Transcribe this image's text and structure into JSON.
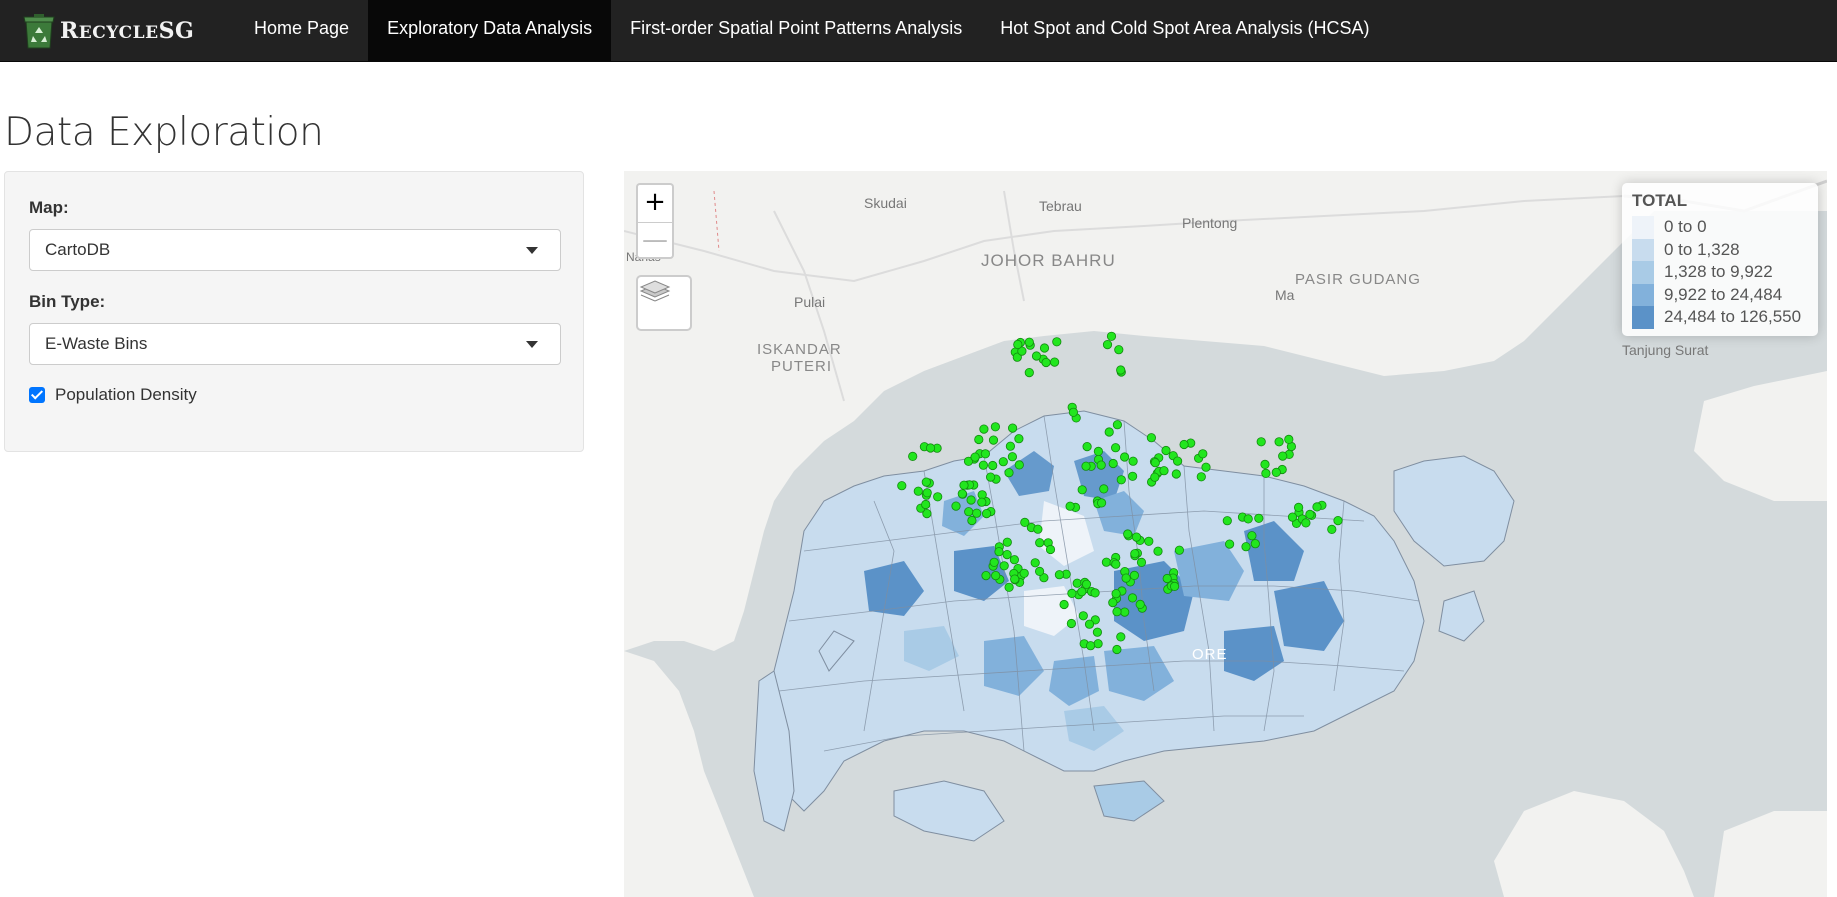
{
  "brand": {
    "name_big": "R",
    "name_rest": "ECYCLE",
    "name_sg": "SG"
  },
  "nav": {
    "items": [
      {
        "label": "Home Page",
        "active": false
      },
      {
        "label": "Exploratory Data Analysis",
        "active": true
      },
      {
        "label": "First-order Spatial Point Patterns Analysis",
        "active": false
      },
      {
        "label": "Hot Spot and Cold Spot Area Analysis (HCSA)",
        "active": false
      }
    ]
  },
  "page": {
    "title": "Data Exploration"
  },
  "sidebar": {
    "map_label": "Map:",
    "map_value": "CartoDB",
    "bin_label": "Bin Type:",
    "bin_value": "E-Waste Bins",
    "population_label": "Population Density",
    "population_checked": true
  },
  "map": {
    "zoom_in": "+",
    "zoom_out": "—",
    "places": {
      "skudai": "Skudai",
      "tebrau": "Tebrau",
      "plentong": "Plentong",
      "johor_bahru": "JOHOR BAHRU",
      "pasir_gudang": "PASIR GUDANG",
      "ma": "Ma",
      "pulai": "Pulai",
      "iskandar": "ISKANDAR",
      "puteri": "PUTERI",
      "tanjung_surat": "Tanjung Surat",
      "nanas": "Nanas",
      "singapore_partial": "ORE"
    },
    "legend": {
      "title": "TOTAL",
      "entries": [
        {
          "label": "0 to 0",
          "color": "#eef3f9"
        },
        {
          "label": "0 to 1,328",
          "color": "#c8dcee"
        },
        {
          "label": "1,328 to 9,922",
          "color": "#a9cbe6"
        },
        {
          "label": "9,922 to 24,484",
          "color": "#82b1db"
        },
        {
          "label": "24,484 to 126,550",
          "color": "#5b92c8"
        }
      ]
    },
    "colors": {
      "water": "#d4dadc",
      "land": "#f2f2f0",
      "bin_point": "#22e61e"
    }
  }
}
